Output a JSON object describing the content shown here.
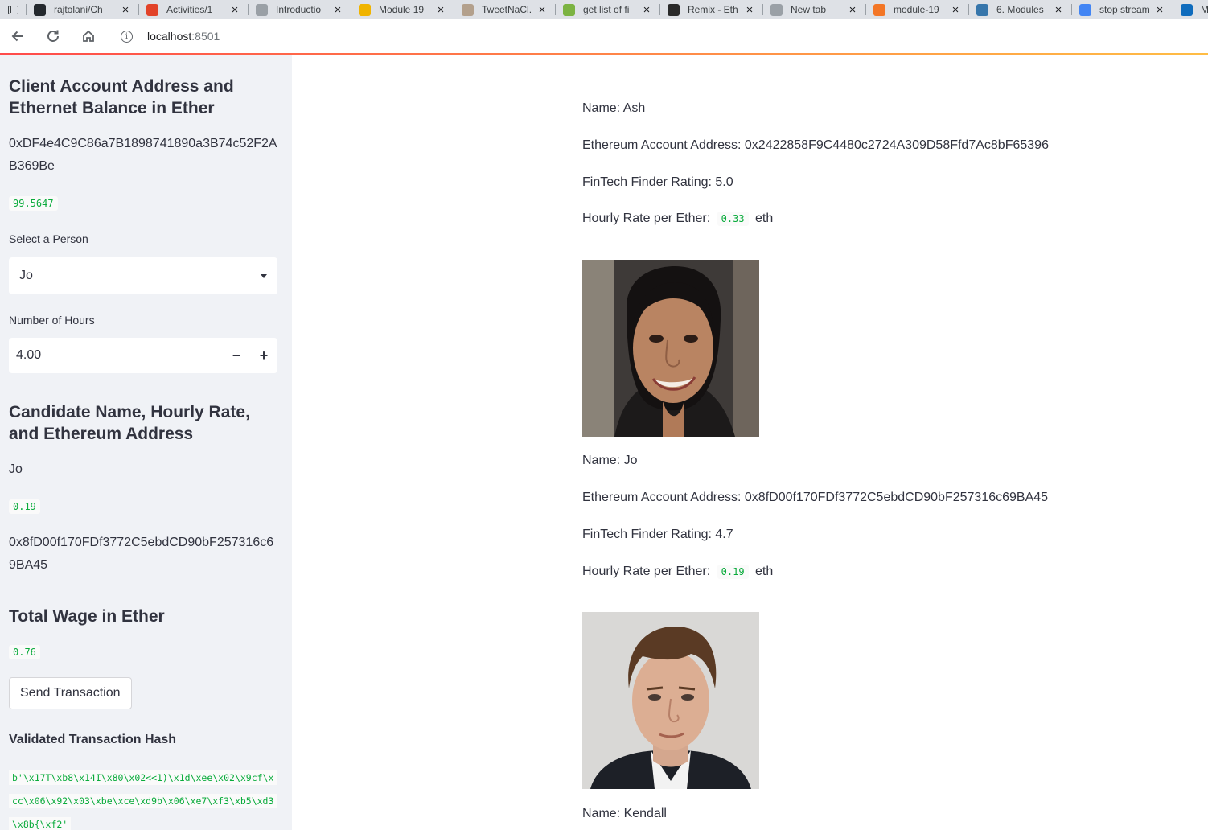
{
  "browser": {
    "tabs": [
      {
        "title": "rajtolani/Ch",
        "icon": "github-icon",
        "color": "#24292e"
      },
      {
        "title": "Activities/1",
        "icon": "gitlab-icon",
        "color": "#e24329"
      },
      {
        "title": "Introductio",
        "icon": "doc-icon",
        "color": "#9aa0a6"
      },
      {
        "title": "Module 19",
        "icon": "module-icon",
        "color": "#f0b400"
      },
      {
        "title": "TweetNaCl.",
        "icon": "tweetnacl-icon",
        "color": "#b3a08c"
      },
      {
        "title": "get list of fi",
        "icon": "tool-icon",
        "color": "#7cb342"
      },
      {
        "title": "Remix - Eth",
        "icon": "remix-icon",
        "color": "#2a2a2a"
      },
      {
        "title": "New tab",
        "icon": "newtab-icon",
        "color": "#9aa0a6"
      },
      {
        "title": "module-19",
        "icon": "jupyter-icon",
        "color": "#f37626"
      },
      {
        "title": "6. Modules",
        "icon": "python-icon",
        "color": "#3776ab"
      },
      {
        "title": "stop stream",
        "icon": "google-icon",
        "color": "#4285f4"
      },
      {
        "title": "Mai",
        "icon": "outlook-icon",
        "color": "#0f6cbd"
      }
    ],
    "url_host": "localhost",
    "url_port": ":8501"
  },
  "sidebar": {
    "account_header": "Client Account Address and Ethernet Balance in Ether",
    "account_address": "0xDF4e4C9C86a7B1898741890a3B74c52F2AB369Be",
    "balance": "99.5647",
    "select_label": "Select a Person",
    "selected_person": "Jo",
    "hours_label": "Number of Hours",
    "hours_value": "4.00",
    "candidate_header": "Candidate Name, Hourly Rate, and Ethereum Address",
    "candidate_name": "Jo",
    "candidate_rate": "0.19",
    "candidate_address": "0x8fD00f170FDf3772C5ebdCD90bF257316c69BA45",
    "wage_header": "Total Wage in Ether",
    "wage_value": "0.76",
    "send_button": "Send Transaction",
    "hash_header": "Validated Transaction Hash",
    "hash_value": "b'\\x17T\\xb8\\x14I\\x80\\x02<<1)\\x1d\\xee\\x02\\x9cf\\xcc\\x06\\x92\\x03\\xbe\\xce\\xd9b\\x06\\xe7\\xf3\\xb5\\xd3\\x8b{\\xf2'"
  },
  "candidates": [
    {
      "name_line": "Name: Ash",
      "address_line": "Ethereum Account Address: 0x2422858F9C4480c2724A309D58Ffd7Ac8bF65396",
      "rating_line": "FinTech Finder Rating: 5.0",
      "rate_label": "Hourly Rate per Ether:",
      "rate_value": "0.33",
      "rate_unit": "eth"
    },
    {
      "name_line": "Name: Jo",
      "address_line": "Ethereum Account Address: 0x8fD00f170FDf3772C5ebdCD90bF257316c69BA45",
      "rating_line": "FinTech Finder Rating: 4.7",
      "rate_label": "Hourly Rate per Ether:",
      "rate_value": "0.19",
      "rate_unit": "eth"
    },
    {
      "name_line": "Name: Kendall"
    }
  ]
}
